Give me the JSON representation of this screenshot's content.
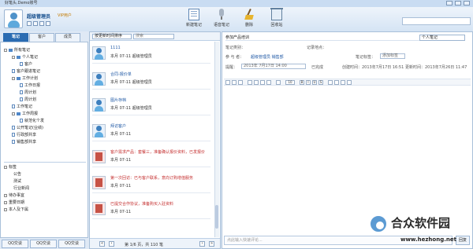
{
  "window": {
    "title": "好笔头.Demo账号"
  },
  "header": {
    "username": "超级管理员",
    "vip": "VIP用户",
    "tools": [
      "新建笔记",
      "语音笔记",
      "删除",
      "回收站"
    ],
    "search_placeholder": ""
  },
  "left_tabs": [
    "笔记",
    "客户",
    "成员"
  ],
  "tree": [
    {
      "label": "所有笔记"
    },
    {
      "label": "个人笔记"
    },
    {
      "label": "客户"
    },
    {
      "label": "客户跟进笔记"
    },
    {
      "label": "工作计划"
    },
    {
      "label": "工作日报"
    },
    {
      "label": "周计划"
    },
    {
      "label": "周计划"
    },
    {
      "label": "工作笔记"
    },
    {
      "label": "工作周报"
    },
    {
      "label": "就范化个发"
    },
    {
      "label": "公开笔记(业绩)"
    },
    {
      "label": "行政部共享"
    },
    {
      "label": "销售部共享"
    }
  ],
  "tags": [
    {
      "label": "标签"
    },
    {
      "label": "公告"
    },
    {
      "label": "测试"
    },
    {
      "label": "行业新闻"
    },
    {
      "label": "待办事宜"
    },
    {
      "label": "重要日期"
    },
    {
      "label": "本人及下属"
    }
  ],
  "bottom_tabs": [
    "QQ交谈",
    "QQ交谈",
    "QQ交谈"
  ],
  "list_toolbar": {
    "sort": "按更新时间排序",
    "filter": "搜索"
  },
  "notes": [
    {
      "title": "1111",
      "date": "本月 07-11  超级管理员"
    },
    {
      "title": "合同-报价单",
      "date": "本月 07-11  超级管理员"
    },
    {
      "title": "图片存档",
      "date": "本月 07-11  超级管理员"
    },
    {
      "title": "拜访客户",
      "date": "本月 07-11"
    },
    {
      "title": "客户需求产品：套餐三，准备确认报价资料，已发报价",
      "date": "本月 07-11"
    },
    {
      "title": "第一次回访：已与客户联系，意向订购增值服务",
      "date": "本月 07-11"
    },
    {
      "title": "已提交合作协议，准备购买入驻资料",
      "date": "本月 07-11"
    }
  ],
  "pagination": {
    "text": "第 1/6 页，共 110 笔"
  },
  "editor": {
    "title": "参加产品培训",
    "type": "个人笔记",
    "category_label": "笔记类别：",
    "record_label": "记录地点：",
    "owner_label": "参 与 者：",
    "owner_value": "超级管理员  销售部",
    "tag_label": "笔记标签：",
    "tag_value": "添加标签",
    "remind_label": "提醒：",
    "remind_value": "2013年 7月17日 14:00",
    "done_label": "已完成",
    "created": "创建时间：2013年7月17日 16:51",
    "updated": "更新时间：2013年7月26日 11:47",
    "font_size": "10",
    "comment_placeholder": "点此输入快速评论...",
    "reply_label": "回复"
  },
  "watermark": {
    "name": "合众软件园",
    "url": "www.hezhong.net"
  },
  "colors": {
    "accent": "#2b6cb2",
    "link": "#1f58a5",
    "red_title": "#c42e2e"
  }
}
